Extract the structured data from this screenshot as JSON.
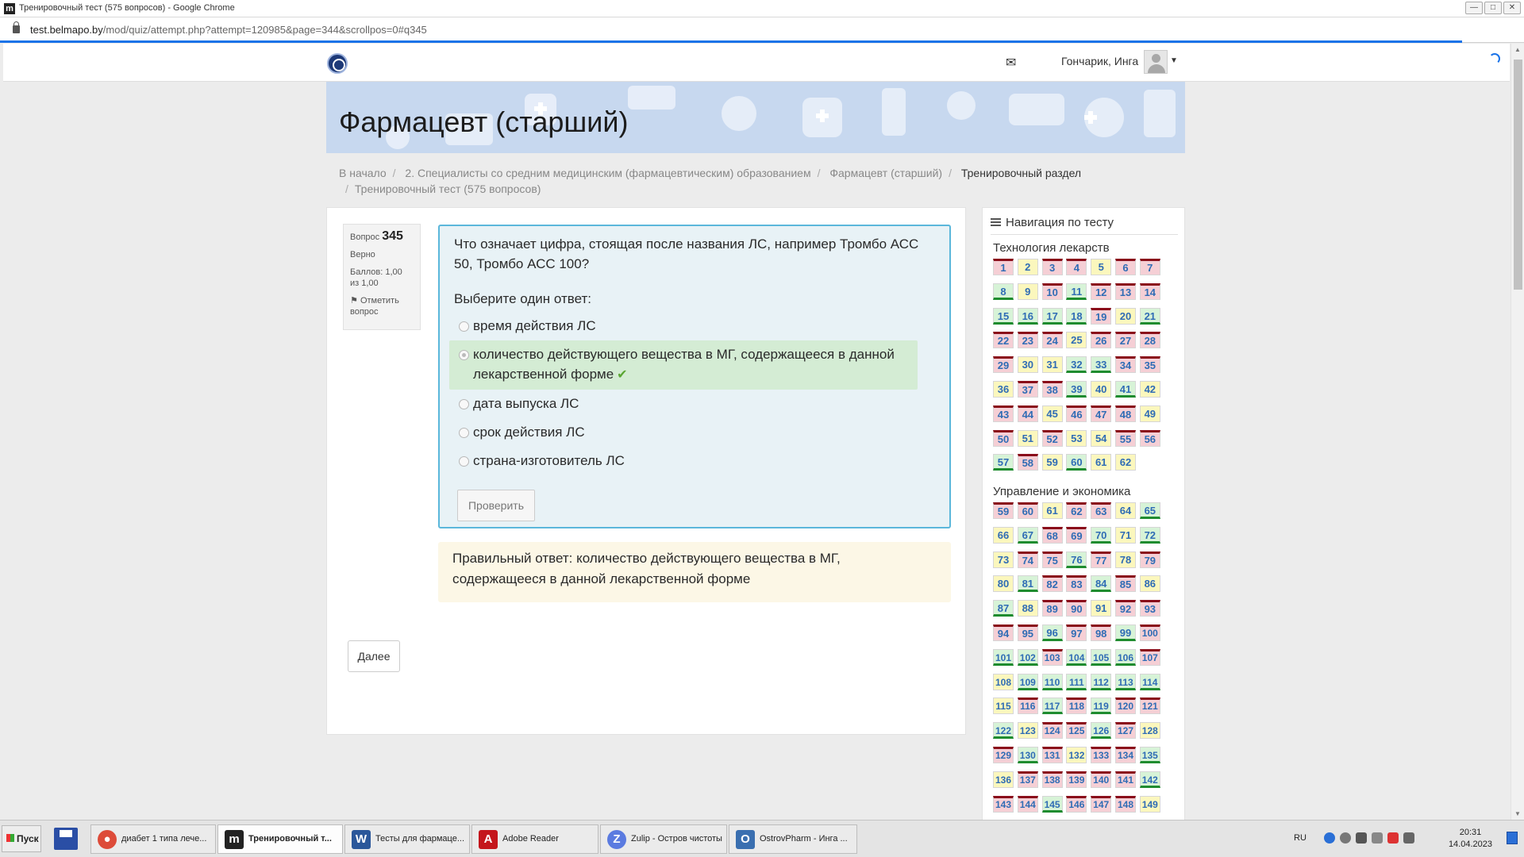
{
  "window": {
    "title": "Тренировочный тест (575 вопросов) - Google Chrome",
    "url_host": "test.belmapo.by",
    "url_path": "/mod/quiz/attempt.php?attempt=120985&page=344&scrollpos=0#q345"
  },
  "navbar": {
    "user_name": "Гончарик, Инга"
  },
  "banner": {
    "course_title": "Фармацевт (старший)"
  },
  "breadcrumb": [
    "В начало",
    "2. Специалисты со средним медицинским (фармацевтическим) образованием",
    "Фармацевт (старший)",
    "Тренировочный раздел",
    "Тренировочный тест (575 вопросов)"
  ],
  "question_info": {
    "label": "Вопрос",
    "number": "345",
    "state": "Верно",
    "score": "Баллов: 1,00 из 1,00",
    "flag": "Отметить вопрос"
  },
  "question": {
    "text": "Что означает цифра, стоящая после названия ЛС, например Тромбо АСС 50, Тромбо АСС 100?",
    "prompt": "Выберите один ответ:",
    "answers": [
      {
        "text": "время действия ЛС",
        "correct": false
      },
      {
        "text": "количество действующего вещества в МГ, содержащееся в данной лекарственной форме",
        "correct": true
      },
      {
        "text": "дата выпуска ЛС",
        "correct": false
      },
      {
        "text": "срок действия ЛС",
        "correct": false
      },
      {
        "text": "страна-изготовитель ЛС",
        "correct": false
      }
    ],
    "check_button": "Проверить",
    "right_answer": "Правильный ответ: количество действующего вещества в МГ, содержащееся в данной лекарственной форме",
    "next_button": "Далее"
  },
  "quiz_nav": {
    "title": "Навигация по тесту",
    "section1_title": "Технология лекарств",
    "section1_states": "wpwwpwwcpwcwwwccccwpcwwwpwwwwppccwwpwwcpcpwwpwwwpwpwppwwcwpcpp",
    "section2_title": "Управление и экономика",
    "section2_states": "wwpwwpcpcwwcpcpwwcwpwpcwwcwpcpwwpwwwwcwwcwccwcccwpccccccpwcwcwwcpwwcwpwcwpwwcpwwwwwcwwcwwwpcwcpwpwcc"
  },
  "taskbar": {
    "start": "Пуск",
    "tasks": [
      "диабет 1 типа лече...",
      "Тренировочный т...",
      "Тесты для фармаце...",
      "Adobe Reader",
      "Zulip - Остров чистоты",
      "OstrovPharm - Инга ..."
    ],
    "lang": "RU",
    "time": "20:31",
    "date": "14.04.2023"
  }
}
